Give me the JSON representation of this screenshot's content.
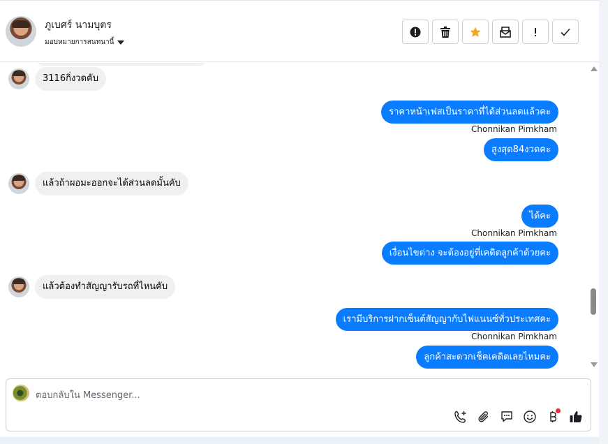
{
  "contact": {
    "name": "ภูเบศร์ นามบุตร",
    "assign_label": "มอบหมายการสนทนานี้"
  },
  "toolbar": {
    "actions": [
      "spam-icon",
      "trash-icon",
      "star-icon",
      "archive-icon",
      "important-icon",
      "done-icon"
    ],
    "star_color": "#f5a623"
  },
  "messages": {
    "m1": "3116กิ่งวดคับ",
    "m2": "ราคาหน้าเฟสเป็นราคาที่ได้ส่วนลดแล้วคะ",
    "m2_sender": "Chonnikan Pimkham",
    "m3": "สูงสุด84งวดคะ",
    "m4": "แล้วถ้าผอมะออกจะได้ส่วนลดมั้นคับ",
    "m5": "ได้คะ",
    "m5_sender": "Chonnikan Pimkham",
    "m6": "เงื่อนไขต่าง จะต้องอยู่ที่เคดิตลูกค้าด้วยคะ",
    "m7": "แล้วต้องทำสัญญารับรถที่ไหนคับ",
    "m8": "เรามีบริการฝากเซ็นต์สัญญากับไฟแนนซ์ทั่วประเทศคะ",
    "m8_sender": "Chonnikan Pimkham",
    "m9": "ลูกค้าสะดวกเช็คเคดิตเลยไหมคะ"
  },
  "composer": {
    "placeholder": "ตอบกลับใน Messenger...",
    "tools": [
      "call-add-icon",
      "attach-icon",
      "saved-reply-icon",
      "emoji-icon",
      "baht-icon",
      "like-icon"
    ]
  },
  "colors": {
    "outgoing_bubble": "#0a7cff",
    "incoming_bubble": "#f0f0f0",
    "notification_dot": "#f02849"
  }
}
